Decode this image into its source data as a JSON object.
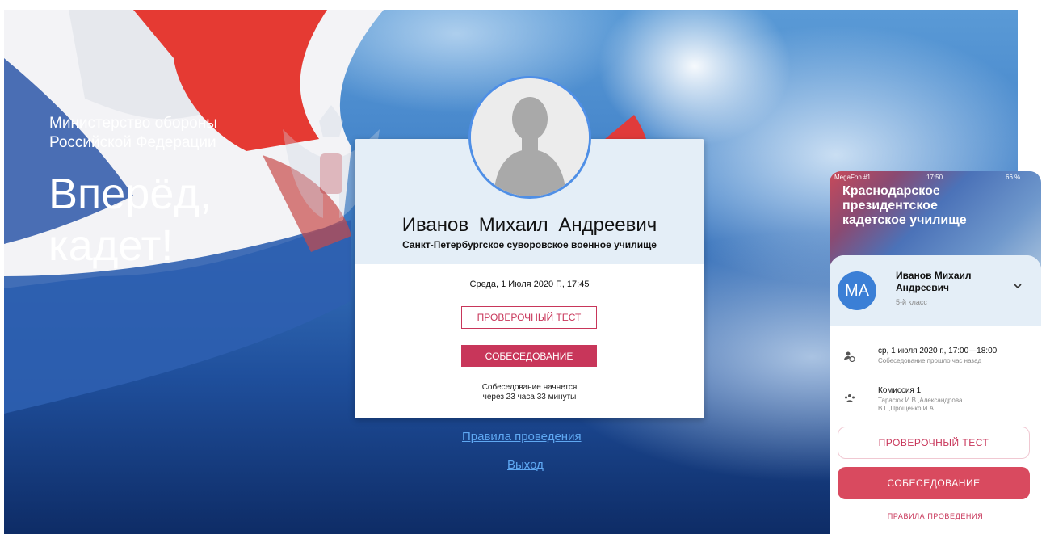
{
  "desktop": {
    "ministry_line1": "Министерство обороны",
    "ministry_line2": "Российской Федерации",
    "slogan_line1": "Вперёд,",
    "slogan_line2": "кадет!",
    "card": {
      "name": "Иванов Михаил Андреевич",
      "school": "Санкт-Петербургское суворовское военное училище",
      "date": "Среда, 1 Июля 2020 Г., 17:45",
      "test_button": "ПРОВЕРОЧНЫЙ ТЕСТ",
      "interview_button": "СОБЕСЕДОВАНИЕ",
      "note_line1": "Собеседование начнется",
      "note_line2": "через 23 часа 33 минуты"
    },
    "rules_link": "Правила проведения",
    "exit_link": "Выход"
  },
  "phone": {
    "status": {
      "carrier": "MegaFon #1",
      "time": "17:50",
      "battery": "66 %"
    },
    "title_line1": "Краснодарское",
    "title_line2": "президентское",
    "title_line3": "кадетское училище",
    "profile": {
      "initials": "MA",
      "name_line1": "Иванов Михаил",
      "name_line2": "Андреевич",
      "class": "5-й класс"
    },
    "schedule": {
      "time": "ср, 1 июля 2020 г., 17:00—18:00",
      "status": "Собеседование прошло час назад"
    },
    "commission": {
      "name": "Комиссия 1",
      "members_line1": "Тарасюк И.В.,Александрова",
      "members_line2": "В.Г.,Прощенко И.А."
    },
    "test_button": "ПРОВЕРОЧНЫЙ ТЕСТ",
    "interview_button": "СОБЕСЕДОВАНИЕ",
    "rules_link": "ПРАВИЛА ПРОВЕДЕНИЯ"
  },
  "colors": {
    "accent": "#c8365a",
    "link": "#5fa8f2",
    "avatar_ring": "#4f8fe6",
    "card_header": "#e4eef7"
  }
}
